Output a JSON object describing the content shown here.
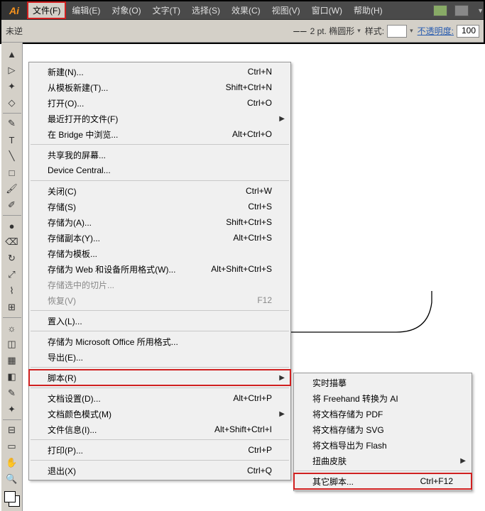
{
  "app": {
    "logo": "Ai"
  },
  "menubar": {
    "items": [
      {
        "label": "文件(F)",
        "active": true
      },
      {
        "label": "编辑(E)"
      },
      {
        "label": "对象(O)"
      },
      {
        "label": "文字(T)"
      },
      {
        "label": "选择(S)"
      },
      {
        "label": "效果(C)"
      },
      {
        "label": "视图(V)"
      },
      {
        "label": "窗口(W)"
      },
      {
        "label": "帮助(H)"
      }
    ]
  },
  "subbar": {
    "left": "未逆",
    "stroke_label": "2 pt. 椭圆形",
    "style_label": "样式:",
    "opacity_label": "不透明度:",
    "opacity_value": "100"
  },
  "file_menu": {
    "items": [
      {
        "label": "新建(N)...",
        "shortcut": "Ctrl+N"
      },
      {
        "label": "从模板新建(T)...",
        "shortcut": "Shift+Ctrl+N"
      },
      {
        "label": "打开(O)...",
        "shortcut": "Ctrl+O"
      },
      {
        "label": "最近打开的文件(F)",
        "submenu": true
      },
      {
        "label": "在 Bridge 中浏览...",
        "shortcut": "Alt+Ctrl+O"
      },
      {
        "sep": true
      },
      {
        "label": "共享我的屏幕..."
      },
      {
        "label": "Device Central..."
      },
      {
        "sep": true
      },
      {
        "label": "关闭(C)",
        "shortcut": "Ctrl+W"
      },
      {
        "label": "存储(S)",
        "shortcut": "Ctrl+S"
      },
      {
        "label": "存储为(A)...",
        "shortcut": "Shift+Ctrl+S"
      },
      {
        "label": "存储副本(Y)...",
        "shortcut": "Alt+Ctrl+S"
      },
      {
        "label": "存储为模板..."
      },
      {
        "label": "存储为 Web 和设备所用格式(W)...",
        "shortcut": "Alt+Shift+Ctrl+S"
      },
      {
        "label": "存储选中的切片...",
        "disabled": true
      },
      {
        "label": "恢复(V)",
        "shortcut": "F12",
        "disabled": true
      },
      {
        "sep": true
      },
      {
        "label": "置入(L)..."
      },
      {
        "sep": true
      },
      {
        "label": "存储为 Microsoft Office 所用格式..."
      },
      {
        "label": "导出(E)..."
      },
      {
        "sep": true
      },
      {
        "label": "脚本(R)",
        "submenu": true,
        "highlight": true
      },
      {
        "sep": true
      },
      {
        "label": "文档设置(D)...",
        "shortcut": "Alt+Ctrl+P"
      },
      {
        "label": "文档颜色模式(M)",
        "submenu": true
      },
      {
        "label": "文件信息(I)...",
        "shortcut": "Alt+Shift+Ctrl+I"
      },
      {
        "sep": true
      },
      {
        "label": "打印(P)...",
        "shortcut": "Ctrl+P"
      },
      {
        "sep": true
      },
      {
        "label": "退出(X)",
        "shortcut": "Ctrl+Q"
      }
    ]
  },
  "script_submenu": {
    "items": [
      {
        "label": "实时描摹"
      },
      {
        "label": "将 Freehand 转换为 AI"
      },
      {
        "label": "将文档存储为 PDF"
      },
      {
        "label": "将文档存储为 SVG"
      },
      {
        "label": "将文档导出为 Flash"
      },
      {
        "label": "扭曲皮肤",
        "submenu": true
      },
      {
        "sep": true
      },
      {
        "label": "其它脚本...",
        "shortcut": "Ctrl+F12",
        "highlight": true
      }
    ]
  },
  "tools": [
    "selection",
    "direct",
    "wand",
    "lasso",
    "pen",
    "type",
    "line",
    "rect",
    "brush",
    "pencil",
    "blob",
    "eraser",
    "rotate",
    "scale",
    "warp",
    "freetrans",
    "symbol",
    "graph",
    "mesh",
    "gradient",
    "eyedrop",
    "blend",
    "slice",
    "artboard",
    "hand",
    "zoom"
  ]
}
